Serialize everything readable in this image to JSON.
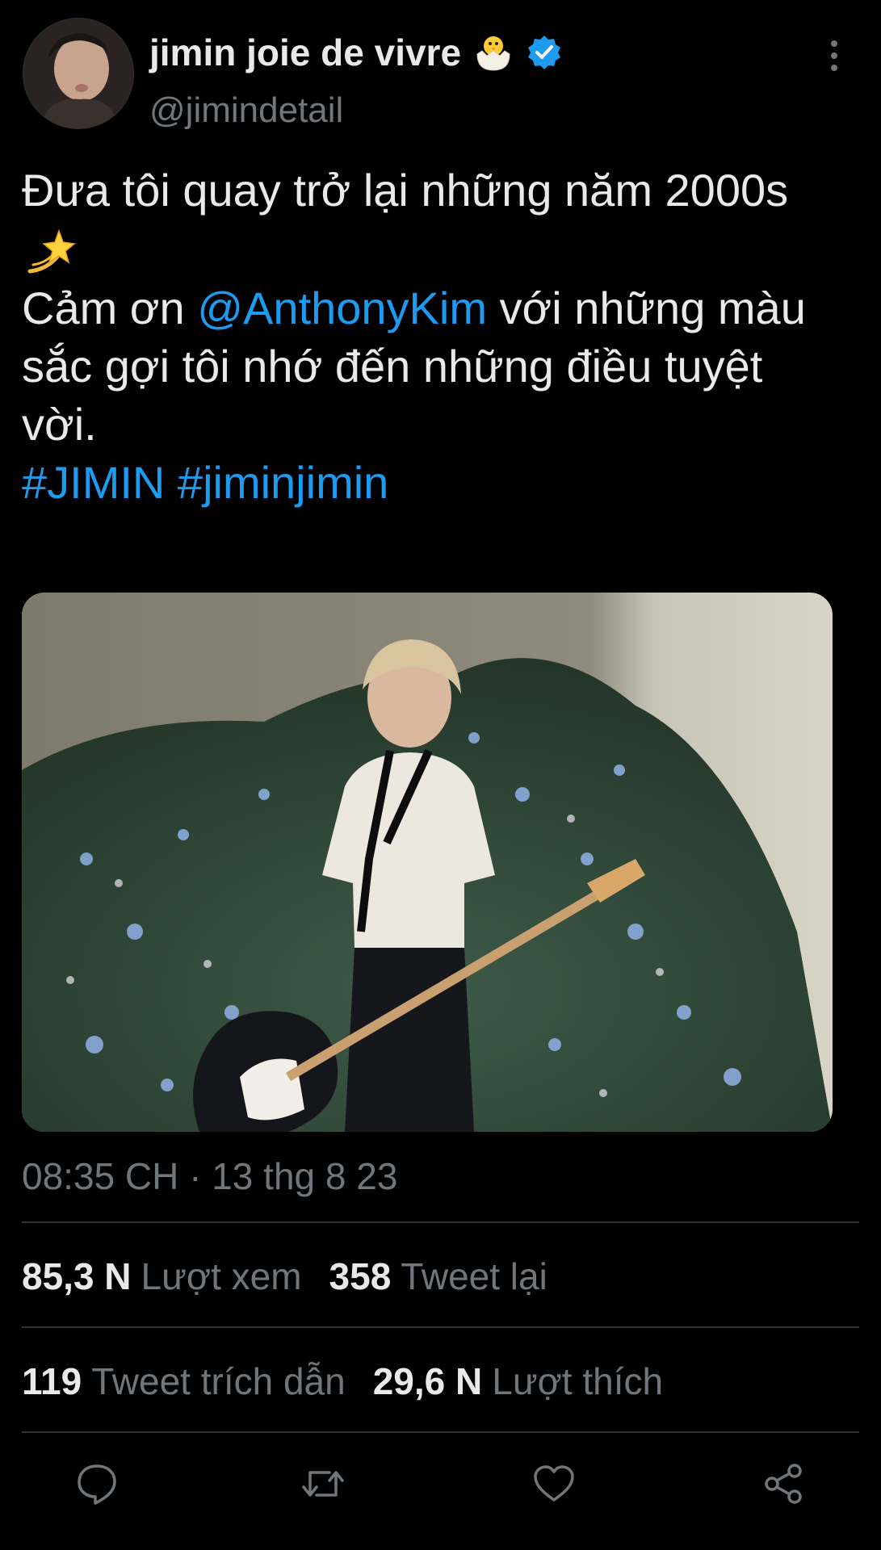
{
  "profile": {
    "display_name": "jimin joie de vivre",
    "handle": "@jimindetail"
  },
  "tweet": {
    "line1": "Đưa tôi quay trở lại những năm 2000s",
    "line3_prefix": "Cảm ơn ",
    "mention": "@AnthonyKim",
    "line3_suffix": " với những màu",
    "line4": "sắc gợi tôi nhớ đến những điều tuyệt",
    "line5": "vời.",
    "hashtag1": "#JIMIN",
    "hashtag2": "#jiminjimin"
  },
  "timestamp": "08:35 CH · 13 thg 8 23",
  "stats": {
    "views_count": "85,3 N",
    "views_label": "Lượt xem",
    "retweets_count": "358",
    "retweets_label": "Tweet lại",
    "quotes_count": "119",
    "quotes_label": "Tweet trích dẫn",
    "likes_count": "29,6 N",
    "likes_label": "Lượt thích"
  },
  "icons": {
    "more": "more-vertical-icon",
    "reply": "reply-icon",
    "retweet": "retweet-icon",
    "like": "heart-icon",
    "share": "share-icon",
    "verified": "verified-badge-icon",
    "emoji_name": "hatching-chick-icon",
    "emoji_tweet": "dizzy-sparkle-icon"
  },
  "colors": {
    "background": "#000000",
    "text": "#e7e9ea",
    "secondary": "#71767b",
    "link": "#1d9bf0",
    "divider": "#2f3336"
  }
}
